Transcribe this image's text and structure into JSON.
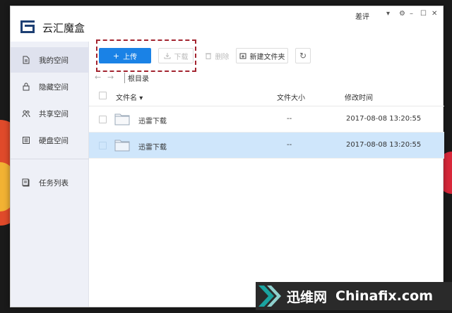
{
  "app": {
    "title": "云汇魔盒",
    "user_name": "差评",
    "controls": [
      "▾",
      "⚙",
      "–",
      "☐",
      "✕"
    ]
  },
  "sidebar": {
    "items": [
      {
        "label": "我的空间",
        "icon": "document-icon",
        "active": true
      },
      {
        "label": "隐藏空间",
        "icon": "lock-icon",
        "active": false
      },
      {
        "label": "共享空间",
        "icon": "users-icon",
        "active": false
      },
      {
        "label": "硬盘空间",
        "icon": "disk-icon",
        "active": false
      },
      {
        "label": "任务列表",
        "icon": "task-list-icon",
        "active": false
      }
    ]
  },
  "toolbar": {
    "upload_label": "上传",
    "download_label": "下载",
    "delete_label": "删除",
    "new_folder_label": "新建文件夹"
  },
  "nav": {
    "breadcrumb": "根目录"
  },
  "table": {
    "headers": {
      "name": "文件名",
      "size": "文件大小",
      "modified": "修改时间"
    },
    "rows": [
      {
        "name": "迅雷下载",
        "size": "--",
        "modified": "2017-08-08 13:20:55",
        "selected": false
      },
      {
        "name": "迅雷下载",
        "size": "--",
        "modified": "2017-08-08 13:20:55",
        "selected": true
      }
    ]
  },
  "watermark": {
    "cn": "迅维网",
    "en": "Chinafix.com"
  },
  "colors": {
    "accent": "#1a82e6",
    "selected_row": "#cfe6fb",
    "sidebar_bg": "#eef0f7",
    "highlight_border": "#a32430"
  }
}
